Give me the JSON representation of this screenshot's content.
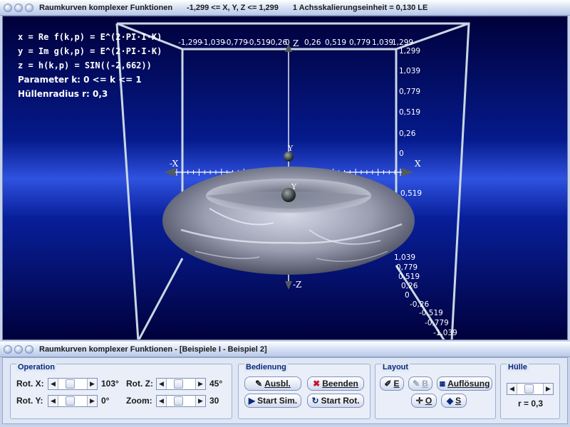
{
  "top_window": {
    "title": "Raumkurven komplexer Funktionen",
    "range": "-1,299 <= X, Y, Z <= 1,299",
    "scale": "1 Achsskalierungseinheit = 0,130 LE"
  },
  "formulas": [
    "x = Re f(k,p) = E^(2·PI·I·K)",
    "y = Im g(k,p) = E^(2·PI·I·K)",
    "z = h(k,p) = SIN((-2,662))"
  ],
  "parameter_line": "Parameter k: 0 <= k <= 1",
  "huellen_line": "Hüllenradius r: 0,3",
  "axes": {
    "x_pos": "X",
    "x_neg": "-X",
    "z_pos": "Z",
    "z_neg": "-Z",
    "y_top": "Y",
    "y_mid": "Y",
    "x_ticks": [
      "-1,299",
      "-1,039",
      "-0,779",
      "-0,519",
      "-0,26",
      "0",
      "0,26",
      "0,519",
      "0,779",
      "1,039",
      "1,299"
    ],
    "z_ticks_right": [
      "1,299",
      "1,039",
      "0,779",
      "0,519",
      "0,26",
      "0",
      "-0,26",
      "-0,519",
      "-0,779",
      "-1,039"
    ],
    "z_ticks_lower": [
      "0,519",
      "1,039",
      "0,779",
      "0,519",
      "0,26",
      "0",
      "-0,26",
      "-0,519",
      "-0,779",
      "-1,039"
    ]
  },
  "bottom_window": {
    "title": "Raumkurven komplexer Funktionen - [Beispiele I - Beispiel 2]"
  },
  "operation": {
    "title": "Operation",
    "rot_x_label": "Rot. X:",
    "rot_x_value": "103°",
    "rot_y_label": "Rot. Y:",
    "rot_y_value": "0°",
    "rot_z_label": "Rot. Z:",
    "rot_z_value": "45°",
    "zoom_label": "Zoom:",
    "zoom_value": "30"
  },
  "bedienung": {
    "title": "Bedienung",
    "ausbl": "Ausbl.",
    "beenden": "Beenden",
    "start_sim": "Start Sim.",
    "start_rot": "Start Rot."
  },
  "layout": {
    "title": "Layout",
    "e": "E",
    "b": "B",
    "aufloesung": "Auflösung",
    "o": "O",
    "s": "S"
  },
  "huelle": {
    "title": "Hülle",
    "r_value": "r = 0,3"
  },
  "colors": {
    "bg_dark": "#00003c",
    "bg_light": "#2b4bd6",
    "frame": "#c4d4e4",
    "torus": "#a8acbc"
  }
}
